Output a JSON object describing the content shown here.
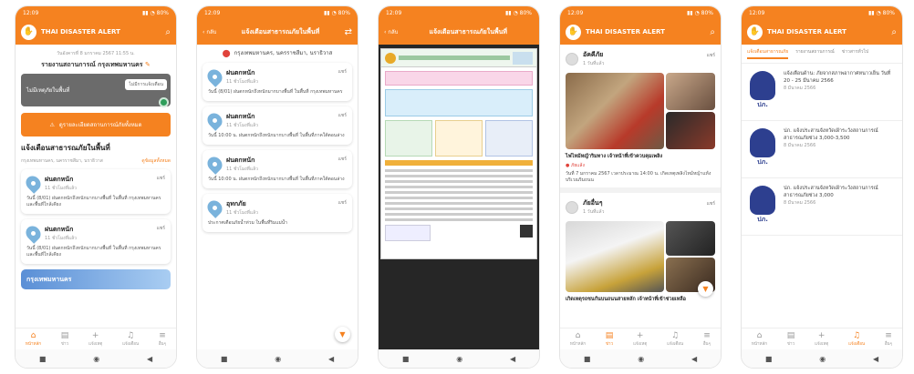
{
  "app": {
    "status_time": "12:09",
    "status_icons": "▮▮ ◔ 80%",
    "brand": "THAI DISASTER ALERT"
  },
  "screen1": {
    "date": "วันอังคารที่ 8 มกราคม 2567 11:55 น.",
    "location": "รายงานสถานการณ์ กรุงเทพมหานคร",
    "gray_box_text": "ไม่มีเหตุภัยในพื้นที่",
    "gray_box_right": "ไม่มีการแจ้งเตือน",
    "orange_button": "ดูรายละเอียดสถานการณ์ภัยทั้งหมด",
    "section": "แจ้งเตือนสาธารณภัยในพื้นที่",
    "area": "กรุงเทพมหานคร, นครราชสีมา, นราธิวาส",
    "see_all": "ดูข้อมูลทั้งหมด",
    "cards": [
      {
        "title": "ฝนตกหนัก",
        "meta": "11 ชั่วโมงที่แล้ว",
        "share": "แชร์",
        "body": "วันนี้ (8/01) ฝนตกหนักถึงหนักมากบางพื้นที่ ในพื้นที่ กรุงเทพมหานคร และพื้นที่ใกล้เคียง"
      },
      {
        "title": "ฝนตกหนัก",
        "meta": "11 ชั่วโมงที่แล้ว",
        "share": "แชร์",
        "body": "วันนี้ (8/01) ฝนตกหนักถึงหนักมากบางพื้นที่ ในพื้นที่ กรุงเทพมหานคร และพื้นที่ใกล้เคียง"
      }
    ],
    "banner": "กรุงเทพมหานคร"
  },
  "screen2": {
    "title": "แจ้งเตือนสาธารณภัยในพื้นที่",
    "back": "กลับ",
    "location": "กรุงเทพมหานคร, นครราชสีมา, นราธิวาส",
    "cards": [
      {
        "title": "ฝนตกหนัก",
        "meta": "11 ชั่วโมงที่แล้ว",
        "share": "แชร์",
        "body": "วันนี้ (8/01) ฝนตกหนักถึงหนักมากบางพื้นที่ ในพื้นที่ กรุงเทพมหานคร"
      },
      {
        "title": "ฝนตกหนัก",
        "meta": "11 ชั่วโมงที่แล้ว",
        "share": "แชร์",
        "body": "วันนี้ 10:00 น. ฝนตกหนักถึงหนักมากบางพื้นที่ ในพื้นที่ภาคใต้ตอนล่าง"
      },
      {
        "title": "ฝนตกหนัก",
        "meta": "11 ชั่วโมงที่แล้ว",
        "share": "แชร์",
        "body": "วันนี้ 10:00 น. ฝนตกหนักถึงหนักมากบางพื้นที่ ในพื้นที่ภาคใต้ตอนล่าง"
      },
      {
        "title": "อุทกภัย",
        "meta": "11 ชั่วโมงที่แล้ว",
        "share": "แชร์",
        "body": "ประกาศเตือนภัยน้ำท่วม ในพื้นที่ริมแม่น้ำ"
      }
    ]
  },
  "screen3": {
    "title": "แจ้งเตือนสาธารณภัยในพื้นที่",
    "back": "กลับ"
  },
  "screen4": {
    "posts": [
      {
        "author": "อัคคีภัย",
        "meta": "1 วันที่แล้ว",
        "share": "แชร์",
        "caption": "ไฟไหม้หญ้าริมทาง เจ้าหน้าที่เข้าควบคุมเพลิง",
        "tag": "ภัยแล้ง",
        "body": "วันที่ 7 มกราคม 2567 เวลาประมาณ 14:00 น. เกิดเหตุเพลิงไหม้หญ้าแห้ง บริเวณริมถนน"
      },
      {
        "author": "ภัยอื่นๆ",
        "meta": "1 วันที่แล้ว",
        "share": "แชร์",
        "caption": "เกิดเหตุรถชนกันบนถนนสายหลัก เจ้าหน้าที่เข้าช่วยเหลือ"
      }
    ]
  },
  "screen5": {
    "tabs": [
      "แจ้งเตือนสาธารณภัย",
      "รายงานสถานการณ์",
      "ข่าวสารทั่วไป"
    ],
    "notifications": [
      {
        "text": "แจ้งเตือนด้าน: ภัยจากสภาพอากาศหนาวเย็น วันที่ 20 - 25 มีนาคม 2566",
        "meta": "8 มีนาคม 2566"
      },
      {
        "text": "ปภ. แจ้งประสานจังหวัดเฝ้าระวังสถานการณ์สาธารณภัยช่วง 3,000-3,500",
        "meta": "8 มีนาคม 2566"
      },
      {
        "text": "ปภ. แจ้งประสานจังหวัดเฝ้าระวังสถานการณ์สาธารณภัยช่วง 3,000",
        "meta": "8 มีนาคม 2566"
      }
    ],
    "logo_abbr": "ปภ."
  },
  "nav": {
    "home": "หน้าหลัก",
    "feed": "ข่าว",
    "report": "แจ้งเหตุ",
    "notify": "แจ้งเตือน",
    "menu": "อื่นๆ"
  },
  "colors": {
    "accent": "#f58220",
    "pin": "#7ab3dc",
    "logo": "#2d3f8f"
  }
}
